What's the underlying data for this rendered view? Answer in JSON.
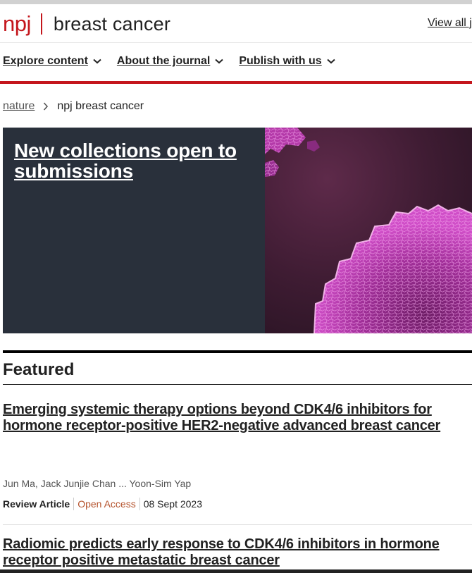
{
  "header": {
    "brand_npj": "npj",
    "brand_title": "breast cancer",
    "view_all": "View all j"
  },
  "nav": {
    "items": [
      {
        "label": "Explore content"
      },
      {
        "label": "About the journal"
      },
      {
        "label": "Publish with us"
      }
    ]
  },
  "breadcrumb": {
    "home": "nature",
    "current": "npj breast cancer"
  },
  "hero": {
    "title": "New collections open to submissions",
    "image_icon": "cell-cluster-image"
  },
  "featured": {
    "heading": "Featured",
    "articles": [
      {
        "title": "Emerging systemic therapy options beyond CDK4/6 inhibitors for hormone receptor-positive HER2-negative advanced breast cancer",
        "authors": "Jun Ma, Jack Junjie Chan ... Yoon-Sim Yap",
        "type": "Review Article",
        "access": "Open Access",
        "date": "08 Sept 2023"
      },
      {
        "title": "Radiomic predicts early response to CDK4/6 inhibitors in hormone receptor positive metastatic breast cancer"
      }
    ]
  },
  "colors": {
    "brand_red": "#c4161c",
    "hero_bg": "#29303b",
    "open_access": "#b5532d"
  }
}
